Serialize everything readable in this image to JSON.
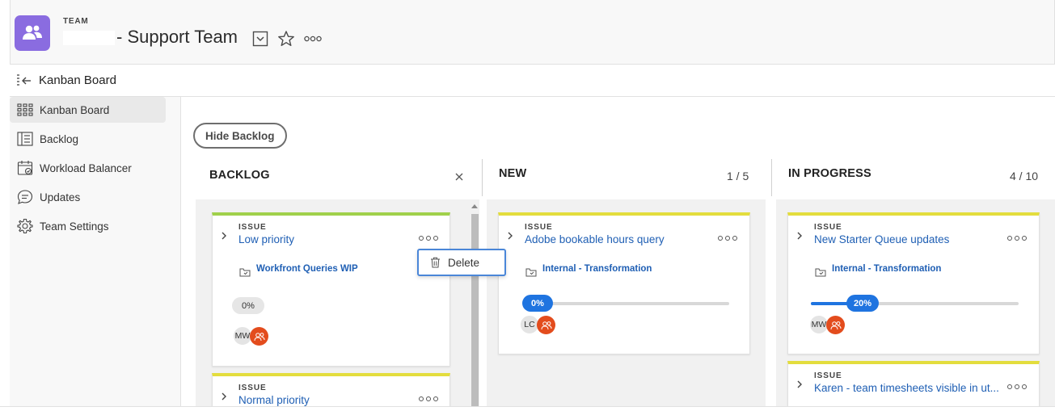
{
  "header": {
    "team_label": "TEAM",
    "team_name": "- Support Team",
    "icons": [
      "team-icon",
      "dropdown-icon",
      "star-icon",
      "more-icon"
    ]
  },
  "subheader": {
    "title": "Kanban Board",
    "icon": "collapse-panel-icon"
  },
  "sidebar": {
    "items": [
      {
        "label": "Kanban Board",
        "icon": "kanban-grid-icon",
        "active": true
      },
      {
        "label": "Backlog",
        "icon": "backlog-icon",
        "active": false
      },
      {
        "label": "Workload Balancer",
        "icon": "calendar-icon",
        "active": false
      },
      {
        "label": "Updates",
        "icon": "chat-bubble-icon",
        "active": false
      },
      {
        "label": "Team Settings",
        "icon": "gear-icon",
        "active": false
      }
    ]
  },
  "main": {
    "hide_backlog_label": "Hide Backlog"
  },
  "columns": [
    {
      "name": "BACKLOG",
      "count": "",
      "cards": [
        {
          "kind": "ISSUE",
          "title": "Low priority",
          "project": "Workfront Queries WIP",
          "percent": "0%",
          "progress": 0,
          "assignee": "MW"
        },
        {
          "kind": "ISSUE",
          "title": "Normal priority"
        }
      ]
    },
    {
      "name": "NEW",
      "count": "1 / 5",
      "cards": [
        {
          "kind": "ISSUE",
          "title": "Adobe bookable hours query",
          "project": "Internal - Transformation",
          "percent": "0%",
          "progress": 0,
          "assignee": "LC"
        }
      ]
    },
    {
      "name": "IN PROGRESS",
      "count": "4 / 10",
      "cards": [
        {
          "kind": "ISSUE",
          "title": "New Starter Queue updates",
          "project": "Internal - Transformation",
          "percent": "20%",
          "progress": 0.2,
          "assignee": "MW"
        },
        {
          "kind": "ISSUE",
          "title": "Karen - team timesheets visible in ut..."
        }
      ]
    }
  ],
  "context_menu": {
    "delete_label": "Delete",
    "icon": "trash-icon"
  },
  "colors": {
    "accent_blue": "#1f74e0",
    "link_blue": "#1f5fb4",
    "team_purple": "#8a6ce0",
    "team_avatar_orange": "#e34c1d",
    "card_top_yellow": "#e3dd3d",
    "card_top_green": "#a0d04b"
  }
}
